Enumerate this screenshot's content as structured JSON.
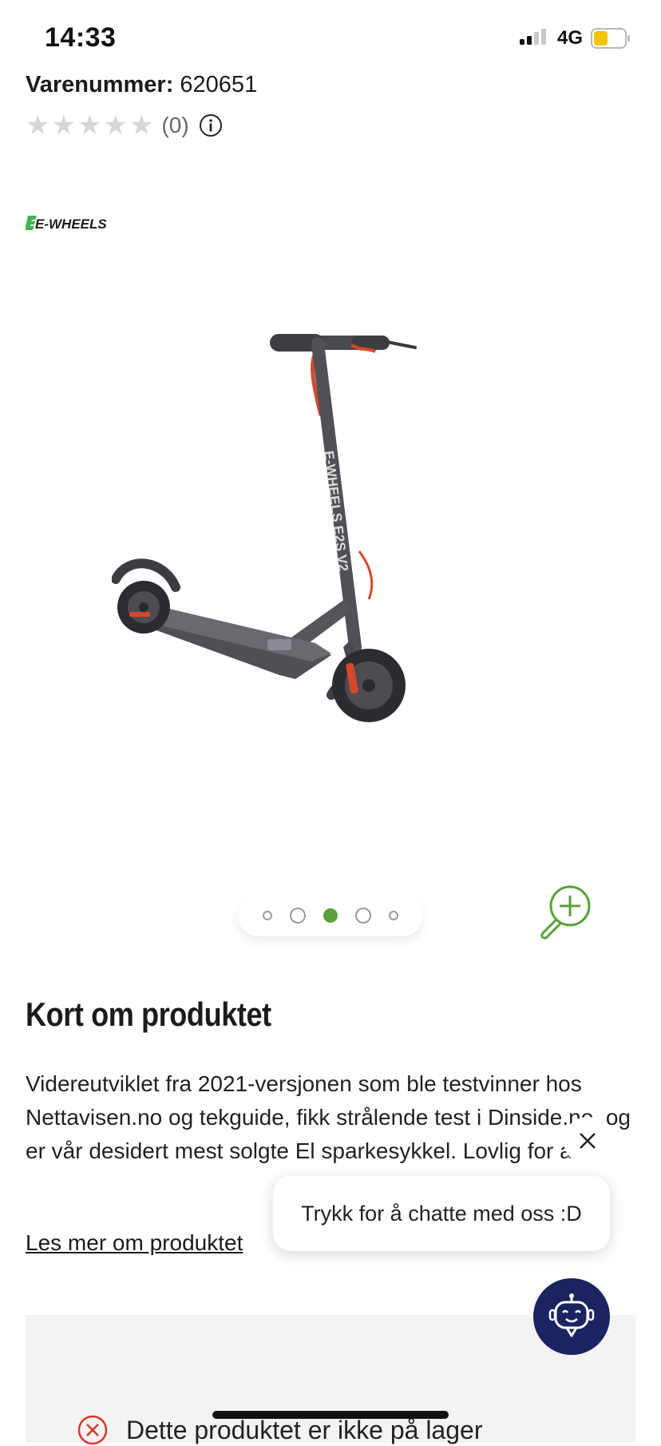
{
  "status_bar": {
    "time": "14:33",
    "network": "4G",
    "battery_color": "#f5c400"
  },
  "product": {
    "sku_label": "Varenummer:",
    "sku_value": "620651",
    "rating_stars": 0,
    "rating_max": 5,
    "review_count": "(0)",
    "brand": "E-WHEELS",
    "image_text": "E-WHEELS E2S V2",
    "gallery": {
      "count": 5,
      "active_index": 3
    }
  },
  "summary": {
    "title": "Kort om produktet",
    "description": "Videreutviklet fra 2021-versjonen som ble testvinner hos Nettavisen.no og tekguide, fikk strålende test i Dinside.no, og er vår desidert mest solgte El sparkesykkel. Lovlig for alle.",
    "read_more": "Les mer om produktet"
  },
  "stock": {
    "text": "Dette produktet er ikke på lager"
  },
  "chat": {
    "prompt": "Trykk for å chatte med oss :D"
  },
  "colors": {
    "brand_green": "#5aa13b",
    "chat_navy": "#1a2460",
    "error_red": "#d9362b"
  },
  "icons": [
    "star-icon",
    "info-icon",
    "zoom-in-icon",
    "close-icon",
    "chatbot-icon",
    "out-of-stock-icon"
  ]
}
